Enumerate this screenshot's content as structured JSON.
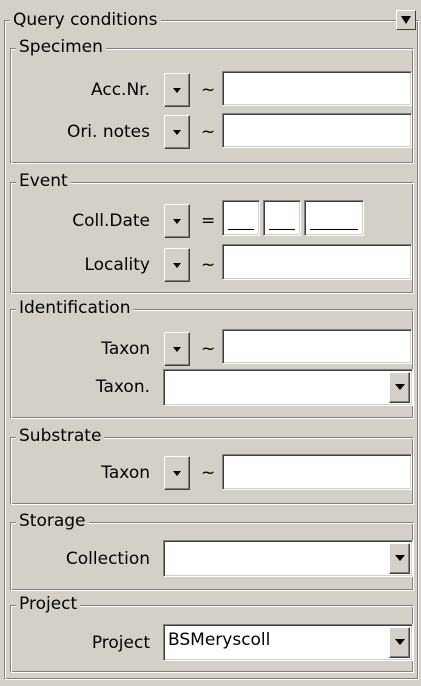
{
  "query": {
    "title": "Query conditions",
    "collapse_icon": "triangle-down-icon"
  },
  "specimen": {
    "title": "Specimen",
    "acc_nr_label": "Acc.Nr.",
    "acc_nr_op": "~",
    "acc_nr_value": "",
    "ori_notes_label": "Ori. notes",
    "ori_notes_op": "~",
    "ori_notes_value": ""
  },
  "event": {
    "title": "Event",
    "coll_date_label": "Coll.Date",
    "coll_date_op": "=",
    "coll_date_day": "",
    "coll_date_month": "",
    "coll_date_year": "",
    "locality_label": "Locality",
    "locality_op": "~",
    "locality_value": ""
  },
  "identification": {
    "title": "Identification",
    "taxon_label": "Taxon",
    "taxon_op": "~",
    "taxon_value": "",
    "taxon_list_label": "Taxon.",
    "taxon_list_value": ""
  },
  "substrate": {
    "title": "Substrate",
    "taxon_label": "Taxon",
    "taxon_op": "~",
    "taxon_value": ""
  },
  "storage": {
    "title": "Storage",
    "collection_label": "Collection",
    "collection_value": ""
  },
  "project": {
    "title": "Project",
    "project_label": "Project",
    "project_value": "BSMeryscoll"
  },
  "colors": {
    "face": "#d4d0c8",
    "field": "#ffffff",
    "shadow": "#808080",
    "highlight": "#ffffff"
  }
}
